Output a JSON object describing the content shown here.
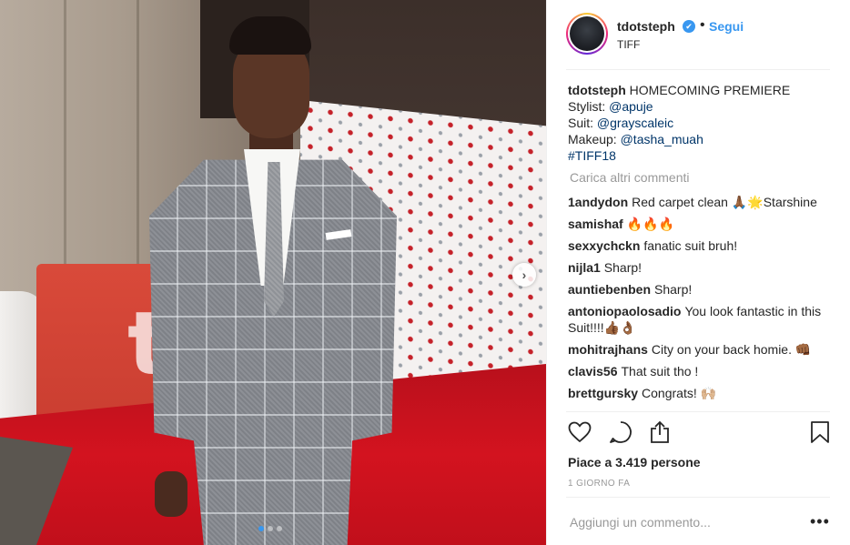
{
  "post": {
    "username": "tdotsteph",
    "follow_label": "Segui",
    "location": "TIFF",
    "separator": "•",
    "verified_mark": "✔"
  },
  "caption": {
    "username": "tdotsteph",
    "line1": "HOMECOMING PREMIERE",
    "line2_prefix": "Stylist: ",
    "line2_link": "@apuje",
    "line3_prefix": "Suit: ",
    "line3_link": "@grayscaleic",
    "line4_prefix": "Makeup: ",
    "line4_link": "@tasha_muah",
    "line5_link": "#TIFF18"
  },
  "load_more_label": "Carica altri commenti",
  "comments": [
    {
      "user": "1andydon",
      "text": "Red carpet clean 🙏🏾🌟Starshine"
    },
    {
      "user": "samishaf",
      "text": "🔥🔥🔥"
    },
    {
      "user": "sexxychckn",
      "text": "fanatic suit bruh!"
    },
    {
      "user": "nijla1",
      "text": "Sharp!"
    },
    {
      "user": "auntiebenben",
      "text": "Sharp!"
    },
    {
      "user": "antoniopaolosadio",
      "text": "You look fantastic in this Suit!!!!👍🏾👌🏾"
    },
    {
      "user": "mohitrajhans",
      "text": "City on your back homie. 👊🏾"
    },
    {
      "user": "clavis56",
      "text": "That suit tho !"
    },
    {
      "user": "brettgursky",
      "text": "Congrats! 🙌🏼"
    }
  ],
  "likes_text": "Piace a 3.419 persone",
  "time_text": "1 GIORNO FA",
  "add_comment_placeholder": "Aggiungi un commento...",
  "more_label": "•••",
  "carousel": {
    "next_arrow": "›",
    "count": 3,
    "active": 0
  },
  "photo_sign_letter": "t",
  "icons": [
    "heart-icon",
    "comment-icon",
    "share-icon",
    "bookmark-icon",
    "verified-icon"
  ],
  "colors": {
    "link": "#003569",
    "accent": "#3897f0",
    "muted": "#999999",
    "text": "#262626"
  }
}
